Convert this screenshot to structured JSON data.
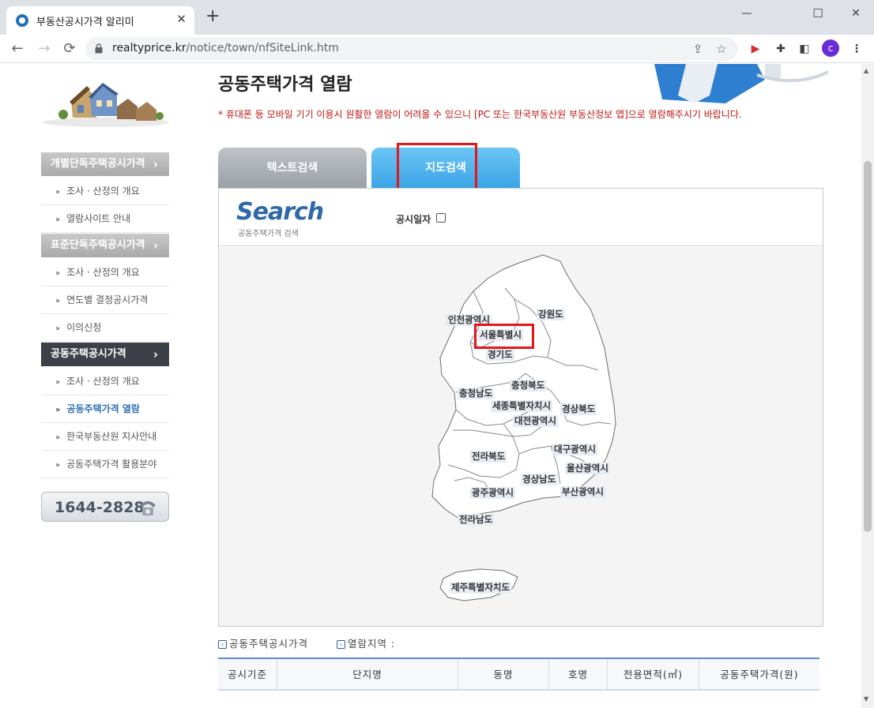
{
  "browser": {
    "tab_title": "부동산공시가격 알리미",
    "tab_close": "✕",
    "new_tab": "+",
    "url_domain": "realtyprice.kr",
    "url_path": "/notice/town/nfSiteLink.htm",
    "avatar_letter": "c",
    "window_min": "—",
    "window_max": "☐",
    "window_close": "✕",
    "back": "←",
    "forward": "→",
    "reload": "⟳"
  },
  "sidebar": {
    "groups": [
      {
        "title": "개별단독주택공시가격",
        "arrow": "›",
        "items": [
          "조사 · 산정의 개요",
          "열람사이트 안내"
        ]
      },
      {
        "title": "표준단독주택공시가격",
        "arrow": "›",
        "items": [
          "조사 · 산정의 개요",
          "연도별 결정공시가격",
          "이의신청"
        ]
      },
      {
        "title": "공동주택공시가격",
        "arrow": "›",
        "items": [
          "조사 · 산정의 개요",
          "공동주택가격 열람",
          "한국부동산원 지사안내",
          "공동주택가격 활용분야"
        ]
      }
    ],
    "bullet": "»",
    "phone": "1644-2828"
  },
  "main": {
    "title": "공동주택가격 열람",
    "notice": "* 휴대폰 등 모바일 기기 이용시 원활한 열람이 어려울 수 있으니 [PC 또는 한국부동산원 부동산정보 앱]으로 열람해주시기 바랍니다.",
    "tabs": [
      "텍스트검색",
      "지도검색"
    ],
    "search_title": "Search",
    "search_subtitle": "공동주택가격 검색",
    "date_label": "공시일자"
  },
  "map": {
    "regions": [
      "인천광역시",
      "강원도",
      "서울특별시",
      "경기도",
      "충청남도",
      "충청북도",
      "세종특별자치시",
      "경상북도",
      "대전광역시",
      "대구광역시",
      "전라북도",
      "울산광역시",
      "경상남도",
      "광주광역시",
      "부산광역시",
      "전라남도",
      "제주특별자치도"
    ]
  },
  "bottom": {
    "link1": "공동주택공시가격",
    "link2": "열람지역 :",
    "icon": "›"
  },
  "table": {
    "headers": [
      "공시기준",
      "단지명",
      "동명",
      "호명",
      "전용면적(㎡)",
      "공동주택가격(원)"
    ]
  },
  "colors": {
    "highlight": "#e3161b",
    "active_tab": "#3aa4e6",
    "notice": "#c0160f"
  }
}
